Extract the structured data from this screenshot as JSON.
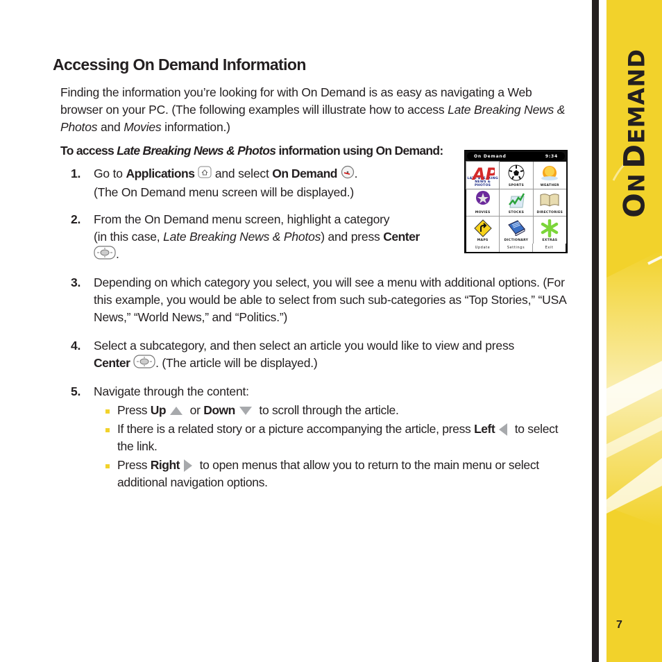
{
  "section_tab": {
    "title_first_letters": [
      "O",
      "D"
    ],
    "title_rest": [
      "N",
      "EMAND"
    ],
    "colors": {
      "tab_yellow": "#f2d22b",
      "tab_black": "#231f20"
    }
  },
  "page_title": "Accessing On Demand Information",
  "intro": {
    "part1": "Finding the information you’re looking for with On Demand is as easy as navigating a Web browser on your PC. (The following examples will illustrate how to access ",
    "italic1": "Late Breaking News & Photos",
    "part2": " and ",
    "italic2": "Movies",
    "part3": " information.)"
  },
  "subhead": {
    "prefix": "To access ",
    "italic": "Late Breaking News & Photos",
    "suffix": " information using On Demand:"
  },
  "steps": [
    {
      "num": "1.",
      "t1": "Go to ",
      "b1": "Applications",
      "t2": " and select ",
      "b2": "On Demand",
      "t3": ".",
      "line2": "(The On Demand menu screen will be displayed.)"
    },
    {
      "num": "2.",
      "line1": "From the On Demand menu screen, highlight a category",
      "t1": "(in this case, ",
      "i1": "Late Breaking News & Photos",
      "t2": ") and press ",
      "b1": "Center",
      "t3": "."
    },
    {
      "num": "3.",
      "text": "Depending on which category you select, you will see a menu with additional options. (For this example, you would be able to select from such sub-categories as “Top Stories,” “USA News,” “World News,” and “Politics.”)"
    },
    {
      "num": "4.",
      "line1": "Select a subcategory, and then select an article you would like to view and press",
      "b1": "Center",
      "t1": ". (The article will be displayed.)"
    },
    {
      "num": "5.",
      "text": "Navigate through the content:"
    }
  ],
  "bullets": [
    {
      "t1": "Press ",
      "b1": "Up",
      "t2": " or ",
      "b2": "Down",
      "t3": " to scroll through the article."
    },
    {
      "t1": "If there is a related story or a picture accompanying the article, press ",
      "b1": "Left",
      "t2": " to select the link."
    },
    {
      "t1": "Press ",
      "b1": "Right",
      "t2": " to open menus that allow you to return to the main menu or select additional navigation options."
    }
  ],
  "phone_screen": {
    "header_title": "On Demand",
    "header_time": "9:34",
    "tiles": [
      {
        "label": "LATE BREAKING NEWS & PHOTOS",
        "icon": "ap-logo-icon",
        "selected": true
      },
      {
        "label": "SPORTS",
        "icon": "soccer-ball-icon"
      },
      {
        "label": "WEATHER",
        "icon": "sun-icon"
      },
      {
        "label": "MOVIES",
        "icon": "star-icon"
      },
      {
        "label": "STOCKS",
        "icon": "stock-chart-icon"
      },
      {
        "label": "DIRECTORIES",
        "icon": "book-open-icon"
      },
      {
        "label": "MAPS",
        "icon": "road-sign-icon"
      },
      {
        "label": "DICTIONARY",
        "icon": "dictionary-icon"
      },
      {
        "label": "EXTRAS",
        "icon": "asterisk-icon"
      }
    ],
    "footer": [
      "Update",
      "Settings",
      "Exit"
    ]
  },
  "page_number": "7"
}
